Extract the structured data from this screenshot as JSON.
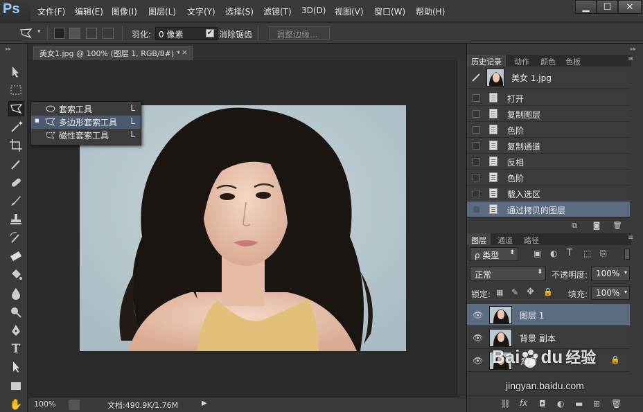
{
  "app": {
    "logo": "Ps"
  },
  "menubar": {
    "items": [
      "文件(F)",
      "编辑(E)",
      "图像(I)",
      "图层(L)",
      "文字(Y)",
      "选择(S)",
      "滤镜(T)",
      "3D(D)",
      "视图(V)",
      "窗口(W)",
      "帮助(H)"
    ],
    "window_buttons": [
      "▁",
      "☐",
      "✕"
    ]
  },
  "options": {
    "feather_label": "羽化:",
    "feather_value": "0 像素",
    "antialias_label": "消除锯齿",
    "antialias_checked": true,
    "refine_label": "调整边缘..."
  },
  "document": {
    "tab_title": "美女1.jpg @ 100% (图层 1, RGB/8#) *",
    "close": "×"
  },
  "status": {
    "zoom": "100%",
    "doc_info": "文档:490.9K/1.76M"
  },
  "flyout": {
    "items": [
      {
        "label": "套索工具",
        "key": "L"
      },
      {
        "label": "多边形套索工具",
        "key": "L",
        "active": true
      },
      {
        "label": "磁性套索工具",
        "key": "L"
      }
    ],
    "active_marker": "■"
  },
  "history_panel": {
    "tabs": [
      "历史记录",
      "动作",
      "颜色",
      "色板"
    ],
    "snapshot": "美女 1.jpg",
    "items": [
      "打开",
      "复制图层",
      "色阶",
      "复制通道",
      "反相",
      "色阶",
      "载入选区",
      "通过拷贝的图层"
    ],
    "selected_index": 7
  },
  "layers_panel": {
    "tabs": [
      "图层",
      "通道",
      "路径"
    ],
    "filter_label": "ρ 类型",
    "blend_mode": "正常",
    "opacity_label": "不透明度:",
    "opacity_value": "100%",
    "lock_label": "锁定:",
    "fill_label": "填充:",
    "fill_value": "100%",
    "layers": [
      {
        "name": "图层 1",
        "selected": true,
        "locked": false
      },
      {
        "name": "背景 副本",
        "selected": false,
        "locked": false
      },
      {
        "name": "背景",
        "selected": false,
        "locked": true
      }
    ]
  },
  "watermark": {
    "brand": "Bai",
    "brand2": "du",
    "suffix": "经验",
    "url": "jingyan.baidu.com"
  },
  "colors": {
    "accent_selected": "#5b6b82",
    "flyout_selected": "#4a5a70"
  }
}
